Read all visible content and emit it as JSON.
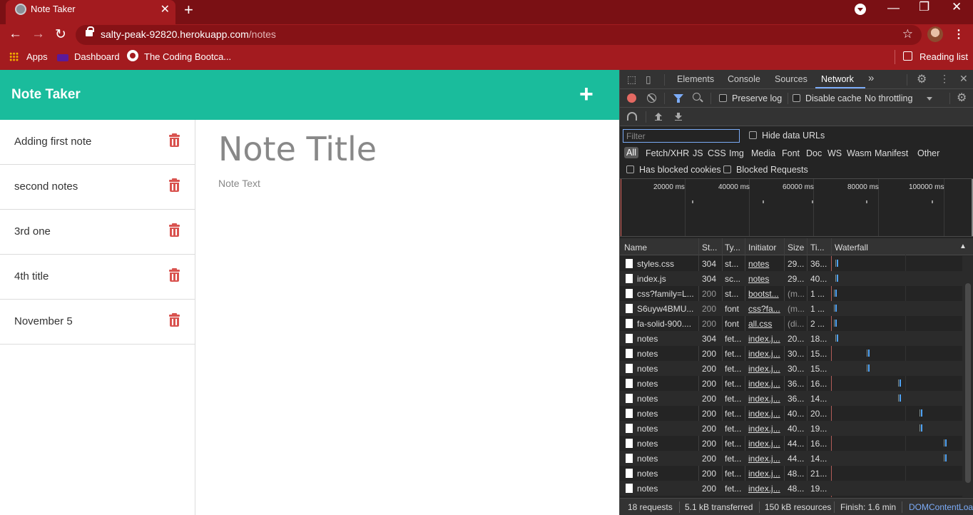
{
  "browser": {
    "tab_title": "Note Taker",
    "tab_close": "✕",
    "new_tab": "+",
    "url_host": "salty-peak-92820.herokuapp.com",
    "url_path": "/notes",
    "bookmarks": [
      "Apps",
      "Dashboard",
      "The Coding Bootca..."
    ],
    "reading_list": "Reading list",
    "window_controls": [
      "—",
      "❐",
      "✕"
    ],
    "nav": [
      "←",
      "→",
      "↻"
    ],
    "star": "☆",
    "menu": "⋮"
  },
  "app": {
    "title": "Note Taker",
    "add_icon": "+",
    "notes": [
      "Adding first note",
      "second notes",
      "3rd one",
      "4th title",
      "November 5"
    ],
    "note_title_placeholder": "Note Title",
    "note_text_placeholder": "Note Text",
    "accent_color": "#1abc9c",
    "trash_color": "#d9534f"
  },
  "devtools": {
    "tabs": [
      "Elements",
      "Console",
      "Sources",
      "Network"
    ],
    "active_tab": "Network",
    "more_tabs": "»",
    "preserve_log": "Preserve log",
    "disable_cache": "Disable cache",
    "throttling": "No throttling",
    "filter_placeholder": "Filter",
    "hide_data_urls": "Hide data URLs",
    "types": [
      "All",
      "Fetch/XHR",
      "JS",
      "CSS",
      "Img",
      "Media",
      "Font",
      "Doc",
      "WS",
      "Wasm",
      "Manifest",
      "Other"
    ],
    "has_blocked_cookies": "Has blocked cookies",
    "blocked_requests": "Blocked Requests",
    "timeline_labels": [
      "20000 ms",
      "40000 ms",
      "60000 ms",
      "80000 ms",
      "100000 ms"
    ],
    "columns": [
      "Name",
      "St...",
      "Ty...",
      "Initiator",
      "Size",
      "Ti...",
      "Waterfall"
    ],
    "rows": [
      {
        "name": "styles.css",
        "status": "304",
        "type": "st...",
        "initiator": "notes",
        "size": "29...",
        "time": "36..."
      },
      {
        "name": "index.js",
        "status": "304",
        "type": "sc...",
        "initiator": "notes",
        "size": "29...",
        "time": "40..."
      },
      {
        "name": "css?family=L...",
        "status": "200",
        "type": "st...",
        "initiator": "bootst...",
        "size": "(m...",
        "time": "1 ..."
      },
      {
        "name": "S6uyw4BMU...",
        "status": "200",
        "type": "font",
        "initiator": "css?fa...",
        "size": "(m...",
        "time": "1 ..."
      },
      {
        "name": "fa-solid-900....",
        "status": "200",
        "type": "font",
        "initiator": "all.css",
        "size": "(di...",
        "time": "2 ..."
      },
      {
        "name": "notes",
        "status": "304",
        "type": "fet...",
        "initiator": "index.j...",
        "size": "20...",
        "time": "18..."
      },
      {
        "name": "notes",
        "status": "200",
        "type": "fet...",
        "initiator": "index.j...",
        "size": "30...",
        "time": "15..."
      },
      {
        "name": "notes",
        "status": "200",
        "type": "fet...",
        "initiator": "index.j...",
        "size": "30...",
        "time": "15..."
      },
      {
        "name": "notes",
        "status": "200",
        "type": "fet...",
        "initiator": "index.j...",
        "size": "36...",
        "time": "16..."
      },
      {
        "name": "notes",
        "status": "200",
        "type": "fet...",
        "initiator": "index.j...",
        "size": "36...",
        "time": "14..."
      },
      {
        "name": "notes",
        "status": "200",
        "type": "fet...",
        "initiator": "index.j...",
        "size": "40...",
        "time": "20..."
      },
      {
        "name": "notes",
        "status": "200",
        "type": "fet...",
        "initiator": "index.j...",
        "size": "40...",
        "time": "19..."
      },
      {
        "name": "notes",
        "status": "200",
        "type": "fet...",
        "initiator": "index.j...",
        "size": "44...",
        "time": "16..."
      },
      {
        "name": "notes",
        "status": "200",
        "type": "fet...",
        "initiator": "index.j...",
        "size": "44...",
        "time": "14..."
      },
      {
        "name": "notes",
        "status": "200",
        "type": "fet...",
        "initiator": "index.j...",
        "size": "48...",
        "time": "21..."
      },
      {
        "name": "notes",
        "status": "200",
        "type": "fet...",
        "initiator": "index.j...",
        "size": "48...",
        "time": "19..."
      }
    ],
    "status": {
      "requests": "18 requests",
      "transferred": "5.1 kB transferred",
      "resources": "150 kB resources",
      "finish": "Finish: 1.6 min",
      "dom": "DOMContentLoa"
    }
  }
}
